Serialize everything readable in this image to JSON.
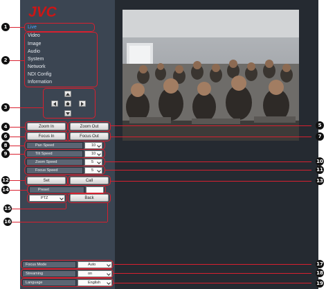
{
  "brand": {
    "logo": "JVC",
    "logo_color": "#cc1616"
  },
  "sidebar": {
    "menu": [
      {
        "label": "Live",
        "active": true
      },
      {
        "label": "Video",
        "active": false
      },
      {
        "label": "Image",
        "active": false
      },
      {
        "label": "Audio",
        "active": false
      },
      {
        "label": "System",
        "active": false
      },
      {
        "label": "Network",
        "active": false
      },
      {
        "label": "NDI Config",
        "active": false
      },
      {
        "label": "Information",
        "active": false
      }
    ]
  },
  "ptz_pad": {
    "icons": [
      "arrow-up-icon",
      "arrow-left-icon",
      "home-icon",
      "arrow-right-icon",
      "arrow-down-icon"
    ]
  },
  "controls": {
    "zoom_in": "Zoom In",
    "zoom_out": "Zoom Out",
    "focus_in": "Focus In",
    "focus_out": "Focus Out",
    "speeds": [
      {
        "label": "Pan Speed",
        "value": "10"
      },
      {
        "label": "Tilt Speed",
        "value": "10"
      },
      {
        "label": "Zoom Speed",
        "value": "5"
      },
      {
        "label": "Focus Speed",
        "value": "5"
      }
    ],
    "set": "Set",
    "call": "Call",
    "preset_label": "Preset",
    "preset_value": "",
    "mode_value": "PTZ",
    "back": "Back"
  },
  "bottom": [
    {
      "label": "Focus Mode",
      "value": "Auto"
    },
    {
      "label": "Streaming",
      "value": "on"
    },
    {
      "label": "Language",
      "value": "English"
    }
  ],
  "callouts": [
    "1",
    "2",
    "3",
    "4",
    "5",
    "6",
    "7",
    "8",
    "9",
    "10",
    "11",
    "12",
    "13",
    "14",
    "15",
    "16",
    "17",
    "18",
    "19"
  ],
  "colors": {
    "sidebar_bg": "#3b4552",
    "main_bg": "#252a31",
    "active_menu": "#4da6ff",
    "highlight": "#d8202f"
  }
}
